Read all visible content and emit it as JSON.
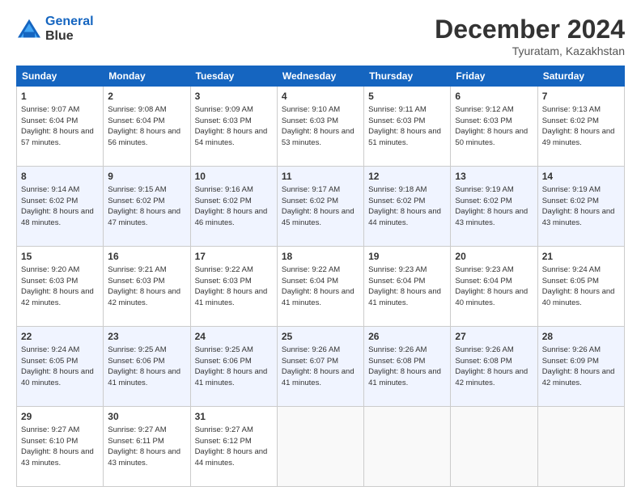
{
  "header": {
    "logo_line1": "General",
    "logo_line2": "Blue",
    "month": "December 2024",
    "location": "Tyuratam, Kazakhstan"
  },
  "columns": [
    "Sunday",
    "Monday",
    "Tuesday",
    "Wednesday",
    "Thursday",
    "Friday",
    "Saturday"
  ],
  "weeks": [
    [
      {
        "day": "1",
        "sunrise": "Sunrise: 9:07 AM",
        "sunset": "Sunset: 6:04 PM",
        "daylight": "Daylight: 8 hours and 57 minutes."
      },
      {
        "day": "2",
        "sunrise": "Sunrise: 9:08 AM",
        "sunset": "Sunset: 6:04 PM",
        "daylight": "Daylight: 8 hours and 56 minutes."
      },
      {
        "day": "3",
        "sunrise": "Sunrise: 9:09 AM",
        "sunset": "Sunset: 6:03 PM",
        "daylight": "Daylight: 8 hours and 54 minutes."
      },
      {
        "day": "4",
        "sunrise": "Sunrise: 9:10 AM",
        "sunset": "Sunset: 6:03 PM",
        "daylight": "Daylight: 8 hours and 53 minutes."
      },
      {
        "day": "5",
        "sunrise": "Sunrise: 9:11 AM",
        "sunset": "Sunset: 6:03 PM",
        "daylight": "Daylight: 8 hours and 51 minutes."
      },
      {
        "day": "6",
        "sunrise": "Sunrise: 9:12 AM",
        "sunset": "Sunset: 6:03 PM",
        "daylight": "Daylight: 8 hours and 50 minutes."
      },
      {
        "day": "7",
        "sunrise": "Sunrise: 9:13 AM",
        "sunset": "Sunset: 6:02 PM",
        "daylight": "Daylight: 8 hours and 49 minutes."
      }
    ],
    [
      {
        "day": "8",
        "sunrise": "Sunrise: 9:14 AM",
        "sunset": "Sunset: 6:02 PM",
        "daylight": "Daylight: 8 hours and 48 minutes."
      },
      {
        "day": "9",
        "sunrise": "Sunrise: 9:15 AM",
        "sunset": "Sunset: 6:02 PM",
        "daylight": "Daylight: 8 hours and 47 minutes."
      },
      {
        "day": "10",
        "sunrise": "Sunrise: 9:16 AM",
        "sunset": "Sunset: 6:02 PM",
        "daylight": "Daylight: 8 hours and 46 minutes."
      },
      {
        "day": "11",
        "sunrise": "Sunrise: 9:17 AM",
        "sunset": "Sunset: 6:02 PM",
        "daylight": "Daylight: 8 hours and 45 minutes."
      },
      {
        "day": "12",
        "sunrise": "Sunrise: 9:18 AM",
        "sunset": "Sunset: 6:02 PM",
        "daylight": "Daylight: 8 hours and 44 minutes."
      },
      {
        "day": "13",
        "sunrise": "Sunrise: 9:19 AM",
        "sunset": "Sunset: 6:02 PM",
        "daylight": "Daylight: 8 hours and 43 minutes."
      },
      {
        "day": "14",
        "sunrise": "Sunrise: 9:19 AM",
        "sunset": "Sunset: 6:02 PM",
        "daylight": "Daylight: 8 hours and 43 minutes."
      }
    ],
    [
      {
        "day": "15",
        "sunrise": "Sunrise: 9:20 AM",
        "sunset": "Sunset: 6:03 PM",
        "daylight": "Daylight: 8 hours and 42 minutes."
      },
      {
        "day": "16",
        "sunrise": "Sunrise: 9:21 AM",
        "sunset": "Sunset: 6:03 PM",
        "daylight": "Daylight: 8 hours and 42 minutes."
      },
      {
        "day": "17",
        "sunrise": "Sunrise: 9:22 AM",
        "sunset": "Sunset: 6:03 PM",
        "daylight": "Daylight: 8 hours and 41 minutes."
      },
      {
        "day": "18",
        "sunrise": "Sunrise: 9:22 AM",
        "sunset": "Sunset: 6:04 PM",
        "daylight": "Daylight: 8 hours and 41 minutes."
      },
      {
        "day": "19",
        "sunrise": "Sunrise: 9:23 AM",
        "sunset": "Sunset: 6:04 PM",
        "daylight": "Daylight: 8 hours and 41 minutes."
      },
      {
        "day": "20",
        "sunrise": "Sunrise: 9:23 AM",
        "sunset": "Sunset: 6:04 PM",
        "daylight": "Daylight: 8 hours and 40 minutes."
      },
      {
        "day": "21",
        "sunrise": "Sunrise: 9:24 AM",
        "sunset": "Sunset: 6:05 PM",
        "daylight": "Daylight: 8 hours and 40 minutes."
      }
    ],
    [
      {
        "day": "22",
        "sunrise": "Sunrise: 9:24 AM",
        "sunset": "Sunset: 6:05 PM",
        "daylight": "Daylight: 8 hours and 40 minutes."
      },
      {
        "day": "23",
        "sunrise": "Sunrise: 9:25 AM",
        "sunset": "Sunset: 6:06 PM",
        "daylight": "Daylight: 8 hours and 41 minutes."
      },
      {
        "day": "24",
        "sunrise": "Sunrise: 9:25 AM",
        "sunset": "Sunset: 6:06 PM",
        "daylight": "Daylight: 8 hours and 41 minutes."
      },
      {
        "day": "25",
        "sunrise": "Sunrise: 9:26 AM",
        "sunset": "Sunset: 6:07 PM",
        "daylight": "Daylight: 8 hours and 41 minutes."
      },
      {
        "day": "26",
        "sunrise": "Sunrise: 9:26 AM",
        "sunset": "Sunset: 6:08 PM",
        "daylight": "Daylight: 8 hours and 41 minutes."
      },
      {
        "day": "27",
        "sunrise": "Sunrise: 9:26 AM",
        "sunset": "Sunset: 6:08 PM",
        "daylight": "Daylight: 8 hours and 42 minutes."
      },
      {
        "day": "28",
        "sunrise": "Sunrise: 9:26 AM",
        "sunset": "Sunset: 6:09 PM",
        "daylight": "Daylight: 8 hours and 42 minutes."
      }
    ],
    [
      {
        "day": "29",
        "sunrise": "Sunrise: 9:27 AM",
        "sunset": "Sunset: 6:10 PM",
        "daylight": "Daylight: 8 hours and 43 minutes."
      },
      {
        "day": "30",
        "sunrise": "Sunrise: 9:27 AM",
        "sunset": "Sunset: 6:11 PM",
        "daylight": "Daylight: 8 hours and 43 minutes."
      },
      {
        "day": "31",
        "sunrise": "Sunrise: 9:27 AM",
        "sunset": "Sunset: 6:12 PM",
        "daylight": "Daylight: 8 hours and 44 minutes."
      },
      null,
      null,
      null,
      null
    ]
  ]
}
